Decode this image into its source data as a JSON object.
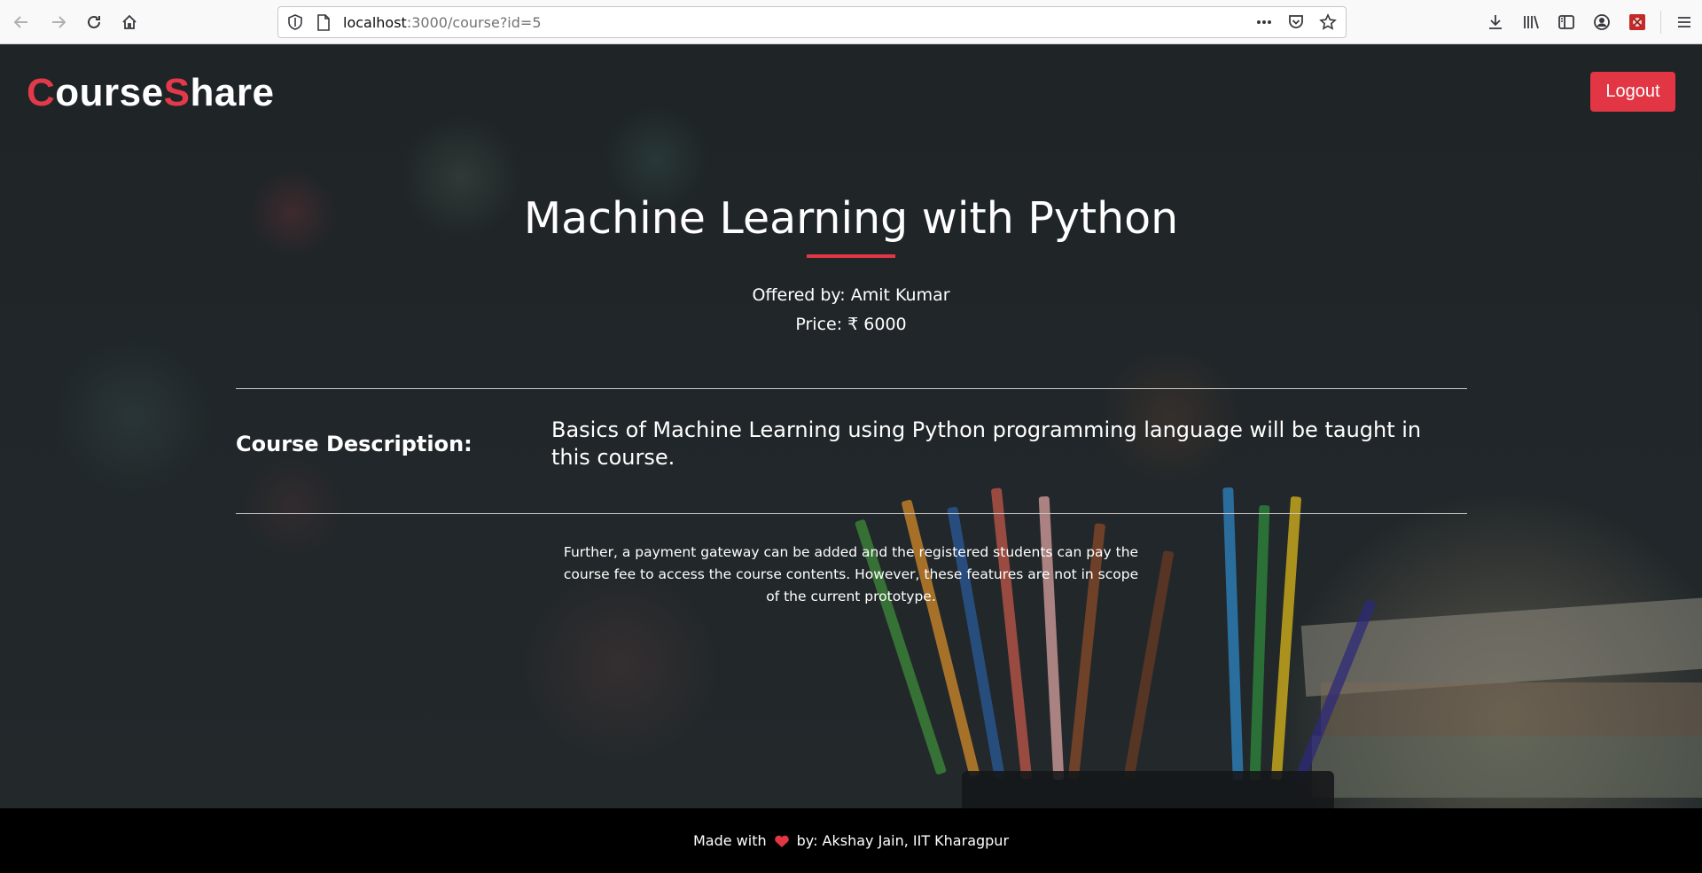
{
  "browser": {
    "url_host": "localhost",
    "url_rest": ":3000/course?id=5",
    "icons": {
      "back": "back-arrow-icon",
      "forward": "forward-arrow-icon",
      "reload": "reload-icon",
      "home": "home-icon",
      "shield": "tracking-protection-shield-icon",
      "page": "page-info-icon",
      "more": "more-actions-icon",
      "pocket": "pocket-icon",
      "bookmark": "bookmark-star-icon",
      "downloads": "download-icon",
      "library": "library-icon",
      "sidebar": "sidebar-icon",
      "account": "account-icon",
      "extension": "extension-icon",
      "menu": "hamburger-menu-icon"
    }
  },
  "header": {
    "brand_first_letter": "C",
    "brand_part1": "ourse",
    "brand_second_letter": "S",
    "brand_part2": "hare",
    "logout_label": "Logout"
  },
  "course": {
    "title": "Machine Learning with Python",
    "offered_by": "Offered by: Amit Kumar",
    "price": "Price: ₹ 6000",
    "description_label": "Course Description:",
    "description": "Basics of Machine Learning using Python programming language will be taught in this course.",
    "note": "Further, a payment gateway can be added and the registered students can pay the course fee to access the course contents. However, these features are not in scope of the current prototype."
  },
  "footer": {
    "made_with": "Made with",
    "credit": "by: Akshay Jain, IIT Kharagpur",
    "heart_icon": "heart-icon"
  },
  "colors": {
    "accent": "#e23645",
    "footer_bg": "#000000"
  }
}
